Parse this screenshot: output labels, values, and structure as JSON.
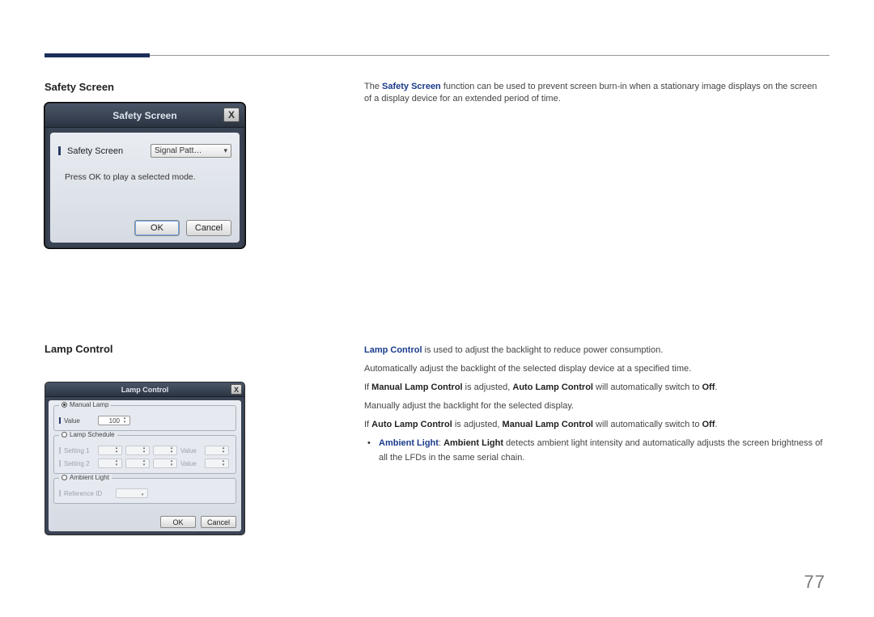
{
  "page_number": "77",
  "safety_screen": {
    "heading": "Safety Screen",
    "desc_prefix": "The ",
    "desc_bold": "Safety Screen",
    "desc_rest": " function can be used to prevent screen burn-in when a stationary image displays on the screen of a display device for an extended period of time.",
    "dialog_title": "Safety Screen",
    "close": "X",
    "row_label": "Safety Screen",
    "dropdown_value": "Signal Patt…",
    "hint": "Press OK to play a selected mode.",
    "ok": "OK",
    "cancel": "Cancel"
  },
  "lamp_control": {
    "heading": "Lamp Control",
    "dialog_title": "Lamp Control",
    "close": "X",
    "group_manual": "Manual Lamp",
    "value_label": "Value",
    "value_num": "100",
    "group_schedule": "Lamp Schedule",
    "setting1": "Setting 1",
    "setting2": "Setting 2",
    "schedule_value_label": "Value",
    "group_ambient": "Ambient Light",
    "reference_id": "Reference ID",
    "ok": "OK",
    "cancel": "Cancel",
    "p1_a": "Lamp Control",
    "p1_b": " is used to adjust the backlight to reduce power consumption.",
    "p2": "Automatically adjust the backlight of the selected display device at a specified time.",
    "p3_a": "If ",
    "p3_b": "Manual Lamp Control",
    "p3_c": " is adjusted, ",
    "p3_d": "Auto Lamp Control",
    "p3_e": " will automatically switch to ",
    "p3_f": "Off",
    "p3_g": ".",
    "p4": "Manually adjust the backlight for the selected display.",
    "p5_a": "If ",
    "p5_b": "Auto Lamp Control",
    "p5_c": " is adjusted, ",
    "p5_d": "Manual Lamp Control",
    "p5_e": " will automatically switch to ",
    "p5_f": "Off",
    "p5_g": ".",
    "li_a": "Ambient Light",
    "li_b": ": ",
    "li_c": "Ambient Light",
    "li_d": " detects ambient light intensity and automatically adjusts the screen brightness of all the LFDs in the same serial chain."
  }
}
